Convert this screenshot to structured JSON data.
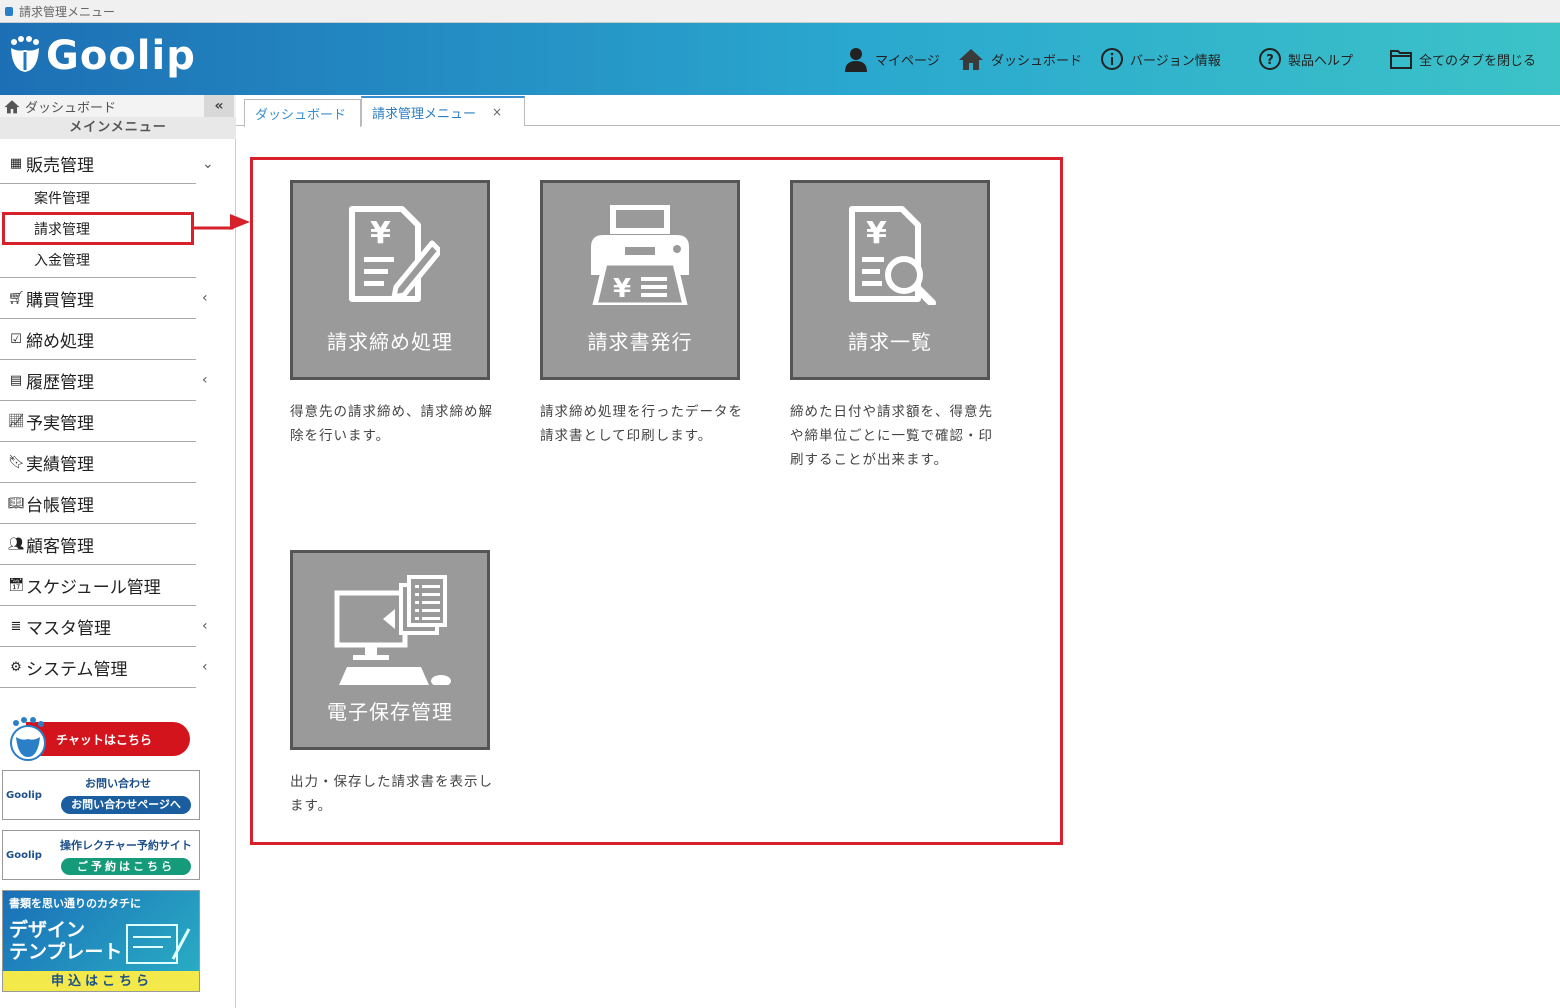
{
  "window": {
    "title": "請求管理メニュー"
  },
  "header": {
    "logo": "Goolip",
    "nav": [
      {
        "label": "マイページ",
        "icon": "user-icon"
      },
      {
        "label": "ダッシュボード",
        "icon": "home-icon"
      },
      {
        "label": "バージョン情報",
        "icon": "info-icon"
      },
      {
        "label": "製品ヘルプ",
        "icon": "help-icon"
      },
      {
        "label": "全てのタブを閉じる",
        "icon": "folder-icon"
      }
    ]
  },
  "sidebar": {
    "dashboard": "ダッシュボード",
    "collapse": "«",
    "main_menu": "メインメニュー",
    "items": [
      {
        "label": "販売管理",
        "icon": "store-icon",
        "chevron": "⌄"
      },
      {
        "label": "購買管理",
        "icon": "cart-icon",
        "chevron": "‹"
      },
      {
        "label": "締め処理",
        "icon": "check-box-icon",
        "chevron": ""
      },
      {
        "label": "履歴管理",
        "icon": "history-icon",
        "chevron": "‹"
      },
      {
        "label": "予実管理",
        "icon": "line-chart-icon",
        "chevron": ""
      },
      {
        "label": "実績管理",
        "icon": "bookmark-icon",
        "chevron": ""
      },
      {
        "label": "台帳管理",
        "icon": "book-icon",
        "chevron": ""
      },
      {
        "label": "顧客管理",
        "icon": "users-icon",
        "chevron": ""
      },
      {
        "label": "スケジュール管理",
        "icon": "calendar-icon",
        "chevron": ""
      },
      {
        "label": "マスタ管理",
        "icon": "database-icon",
        "chevron": "‹"
      },
      {
        "label": "システム管理",
        "icon": "gear-icon",
        "chevron": "‹"
      }
    ],
    "sub_items": [
      "案件管理",
      "請求管理",
      "入金管理"
    ],
    "ads": {
      "chat": "チャットはこちら",
      "inquiry_title": "お問い合わせ",
      "inquiry_button": "お問い合わせページへ",
      "lecture_title": "操作レクチャー予約サイト",
      "lecture_button": "ご予約はこちら",
      "brand": "Goolip",
      "template_top": "書類を思い通りのカタチに",
      "template_l1": "デザイン",
      "template_l2": "テンプレート",
      "template_btn": "申込はこちら"
    }
  },
  "tabs": [
    {
      "label": "ダッシュボード"
    },
    {
      "label": "請求管理メニュー",
      "close": "×"
    }
  ],
  "tiles": [
    {
      "label": "請求締め処理",
      "icon": "invoice-edit-icon",
      "desc": "得意先の請求締め、請求締め解除を行います。"
    },
    {
      "label": "請求書発行",
      "icon": "printer-icon",
      "desc": "請求締め処理を行ったデータを請求書として印刷します。"
    },
    {
      "label": "請求一覧",
      "icon": "invoice-search-icon",
      "desc": "締めた日付や請求額を、得意先や締単位ごとに一覧で確認・印刷することが出来ます。"
    },
    {
      "label": "電子保存管理",
      "icon": "computer-document-icon",
      "desc": "出力・保存した請求書を表示します。"
    }
  ],
  "colors": {
    "highlight": "#d6202a",
    "tile": "#9a9a9a",
    "accent": "#3a8fd0"
  }
}
